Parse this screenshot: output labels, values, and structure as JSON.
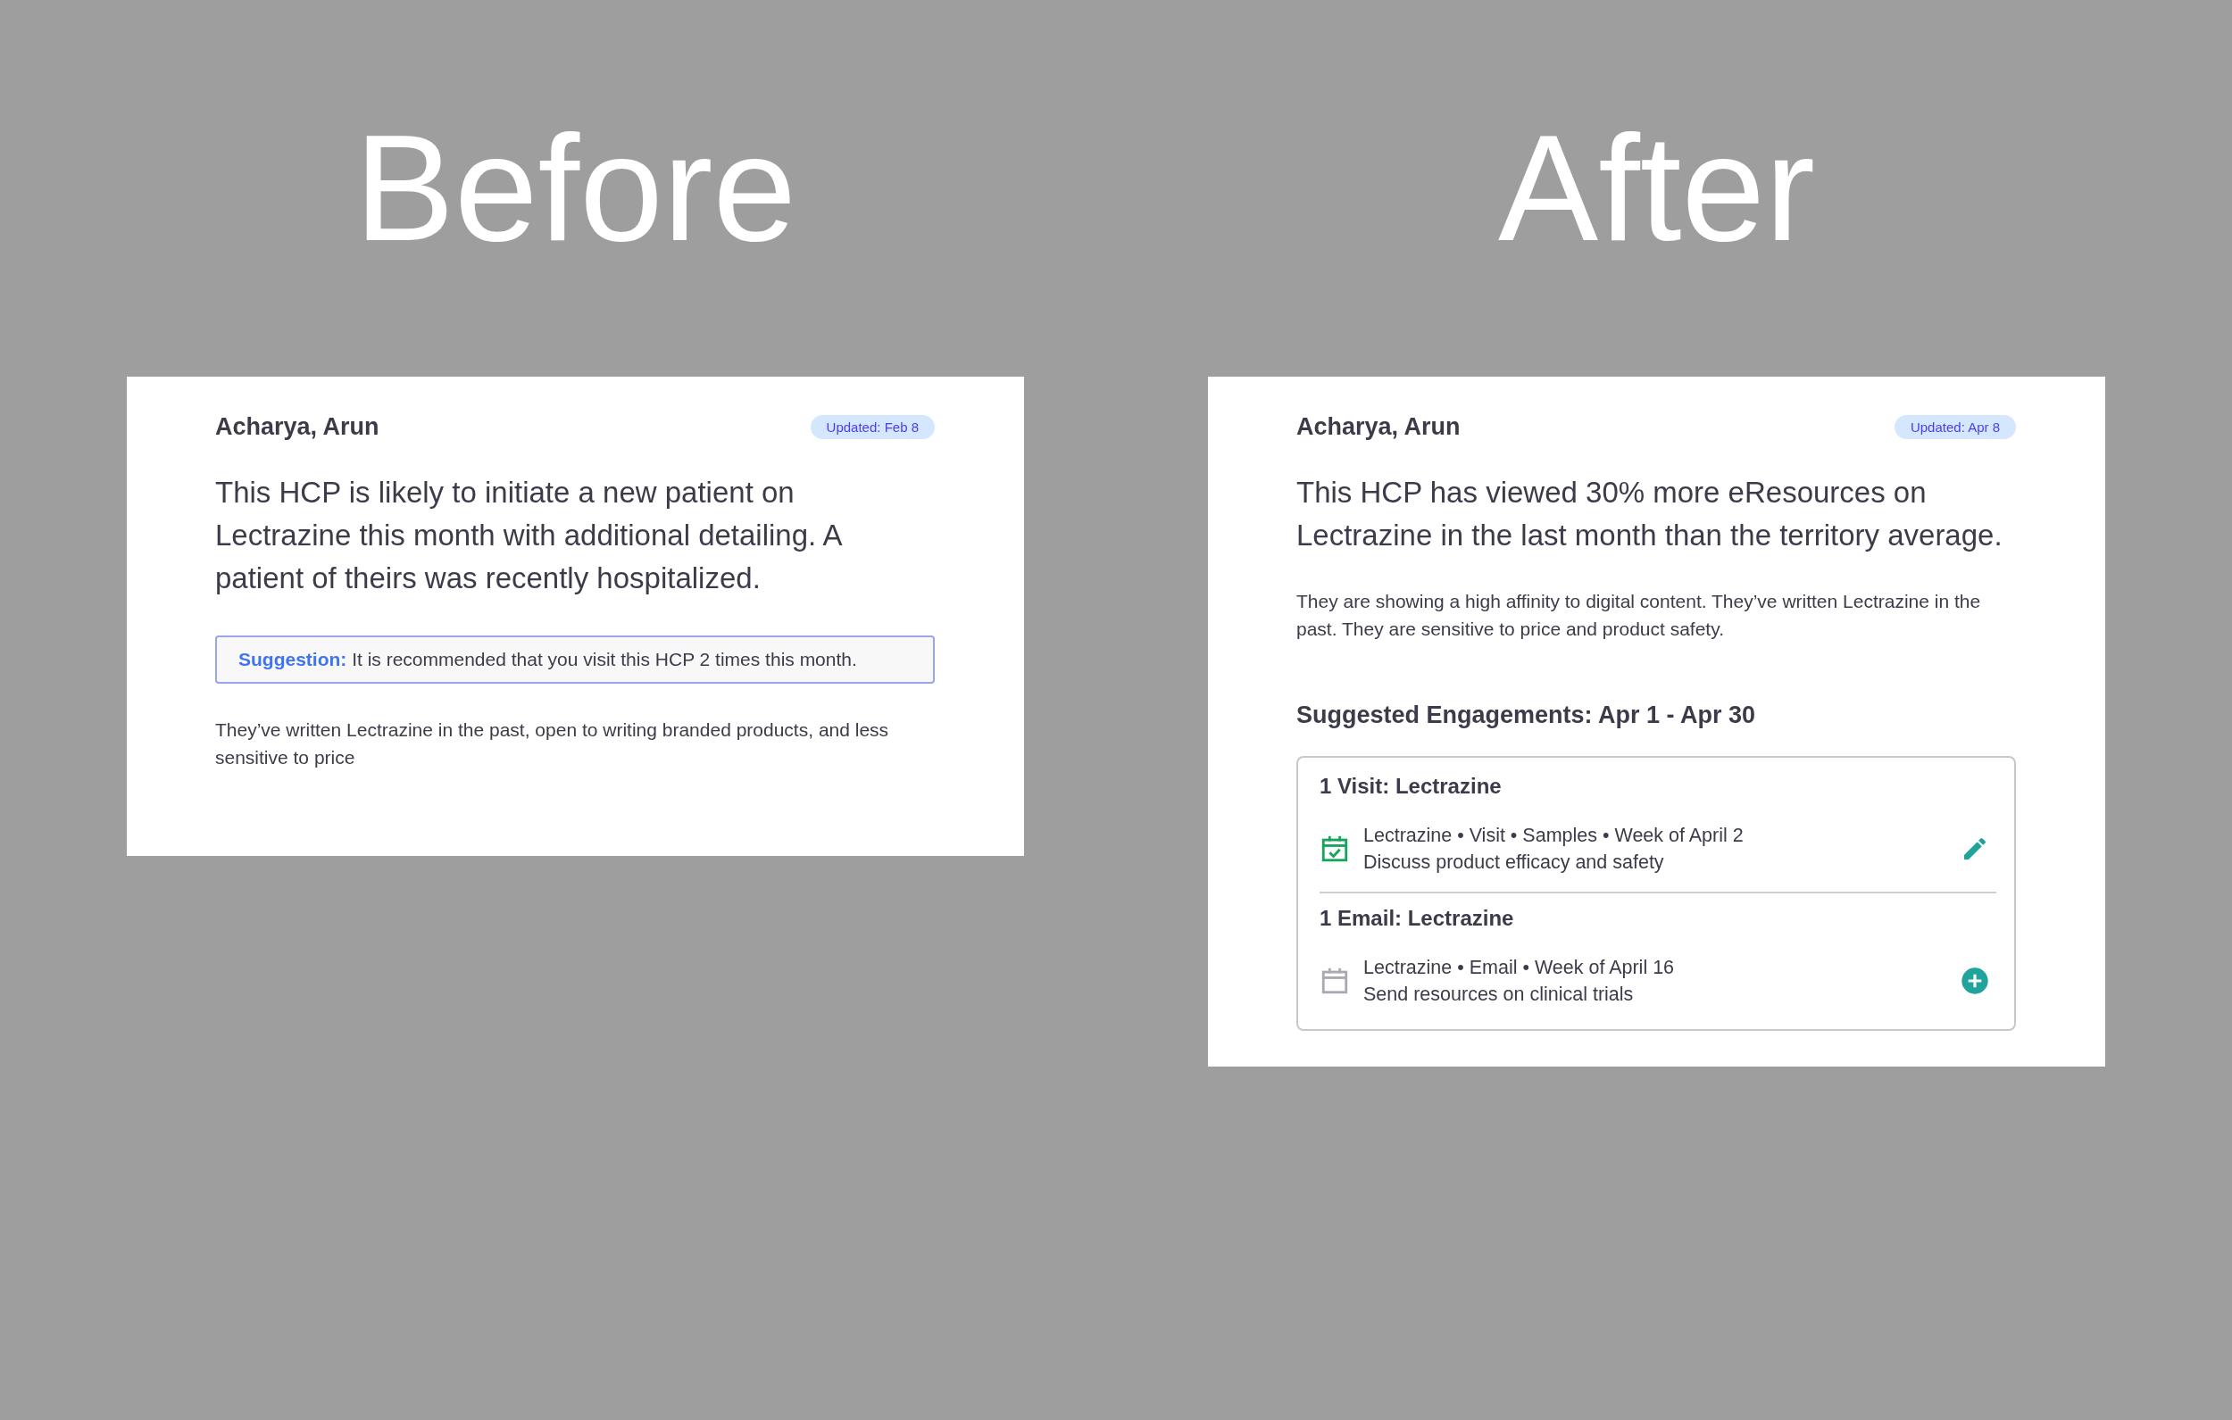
{
  "panels": [
    {
      "heading": "Before",
      "card": {
        "name": "Acharya, Arun",
        "badge": "Updated: Feb 8",
        "headline": "This HCP is likely to initiate a new patient on Lectrazine this month with additional detailing. A patient of theirs was recently hospitalized.",
        "suggestion": "**Suggestion:** It is recommended that you visit this HCP 2 times this month.",
        "note": "They’ve written Lectrazine in the past, open to writing branded products, and less sensitive to price"
      }
    },
    {
      "heading": "After",
      "card": {
        "name": "Acharya, Arun",
        "badge": "Updated: Apr 8",
        "headline": "This HCP has viewed 30% more eResources on Lectrazine in the last month than the territory average.",
        "note": "They are showing a high affinity to digital content.  They’ve written Lectrazine in the past.  They are sensitive to price and product safety.",
        "engagements_title": "Suggested Engagements: Apr 1 - Apr 30",
        "engagements": [
          {
            "title": "1 Visit: Lectrazine",
            "details": "Lectrazine • Visit • Samples • Week of April 2",
            "description": "Discuss product efficacy and safety",
            "scheduled": true
          },
          {
            "title": "1 Email: Lectrazine",
            "details": "Lectrazine • Email • Week of April 16",
            "description": "Send resources on clinical trials",
            "scheduled": false
          }
        ]
      }
    }
  ]
}
